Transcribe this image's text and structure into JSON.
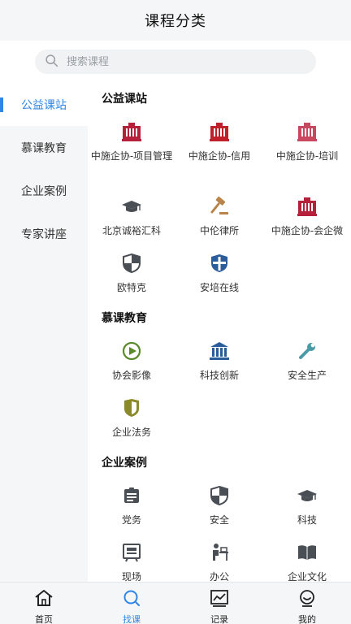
{
  "header": {
    "title": "课程分类"
  },
  "search": {
    "placeholder": "搜索课程",
    "icon": "search-icon"
  },
  "sidebar": {
    "items": [
      {
        "label": "公益课站",
        "active": true
      },
      {
        "label": "慕课教育",
        "active": false
      },
      {
        "label": "企业案例",
        "active": false
      },
      {
        "label": "专家讲座",
        "active": false
      }
    ]
  },
  "sections": [
    {
      "title": "公益课站",
      "items": [
        {
          "label": "中施企协-项目管理",
          "icon": "building-icon"
        },
        {
          "label": "中施企协-信用",
          "icon": "building-icon"
        },
        {
          "label": "中施企协-培训",
          "icon": "building-icon"
        },
        {
          "label": "北京诚裕汇科",
          "icon": "graduation-cap-icon"
        },
        {
          "label": "中伦律所",
          "icon": "gavel-icon"
        },
        {
          "label": "中施企协-会企微",
          "icon": "building-icon"
        },
        {
          "label": "欧特克",
          "icon": "shield-icon"
        },
        {
          "label": "安培在线",
          "icon": "cross-shield-icon"
        }
      ]
    },
    {
      "title": "慕课教育",
      "items": [
        {
          "label": "协会影像",
          "icon": "play-circle-icon"
        },
        {
          "label": "科技创新",
          "icon": "bank-icon"
        },
        {
          "label": "安全生产",
          "icon": "wrench-icon"
        },
        {
          "label": "企业法务",
          "icon": "badge-shield-icon"
        }
      ]
    },
    {
      "title": "企业案例",
      "items": [
        {
          "label": "党务",
          "icon": "id-card-icon"
        },
        {
          "label": "安全",
          "icon": "shield-icon"
        },
        {
          "label": "科技",
          "icon": "graduation-cap-icon"
        },
        {
          "label": "现场",
          "icon": "site-board-icon"
        },
        {
          "label": "办公",
          "icon": "desk-worker-icon"
        },
        {
          "label": "企业文化",
          "icon": "book-icon"
        }
      ]
    }
  ],
  "tabbar": {
    "items": [
      {
        "label": "首页",
        "icon": "home-icon",
        "active": false
      },
      {
        "label": "找课",
        "icon": "search-icon",
        "active": true
      },
      {
        "label": "记录",
        "icon": "chart-icon",
        "active": false
      },
      {
        "label": "我的",
        "icon": "user-icon",
        "active": false
      }
    ]
  },
  "colors": {
    "accent": "#2f86e3",
    "brand_red": "#b5203a",
    "building_pink": "#c9485f",
    "gavel_brown": "#b8844a",
    "green": "#5a8a2a",
    "teal": "#4a9aa8",
    "olive": "#8a8a2a",
    "dark_gray": "#4a4f55",
    "blue_icon": "#2a5d9a"
  }
}
